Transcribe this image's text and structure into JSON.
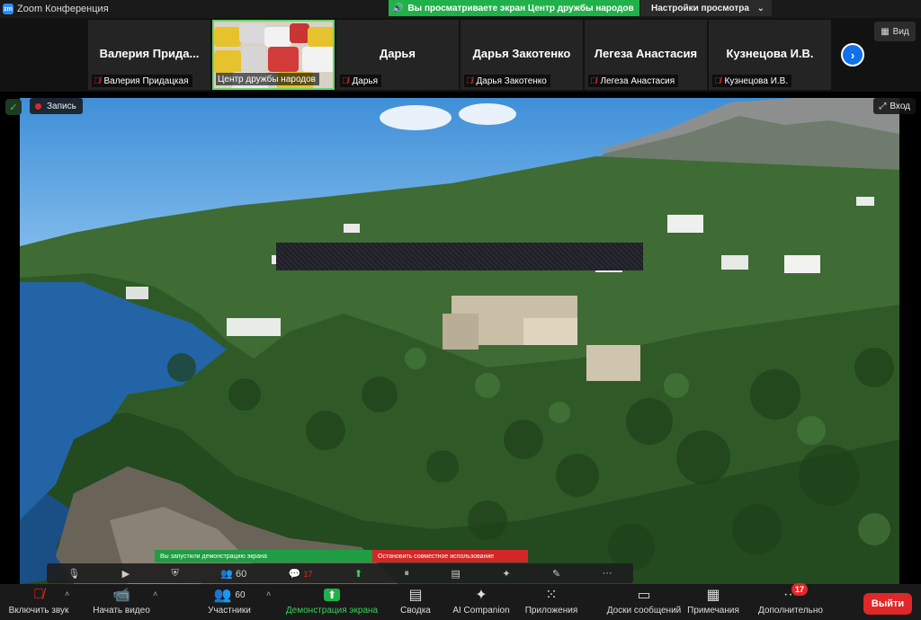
{
  "window": {
    "app_title": "Zoom Конференция",
    "logo": "zm"
  },
  "banner": {
    "text": "Вы просматриваете экран Центр дружбы народов"
  },
  "view_options": {
    "label": "Настройки просмотра"
  },
  "participants": [
    {
      "display_name": "Валерия Придацкая",
      "big_name": "Валерия Прида...",
      "muted": true
    },
    {
      "display_name": "Центр дружбы народов",
      "big_name": "",
      "muted": false,
      "video": true
    },
    {
      "display_name": "Дарья",
      "big_name": "Дарья",
      "muted": true
    },
    {
      "display_name": "Дарья Закотенко",
      "big_name": "Дарья Закотенко",
      "muted": true
    },
    {
      "display_name": "Легеза Анастасия",
      "big_name": "Легеза Анастасия",
      "muted": true
    },
    {
      "display_name": "Кузнецова И.В.",
      "big_name": "Кузнецова И.В.",
      "muted": true
    }
  ],
  "view_button": {
    "label": "Вид"
  },
  "stage": {
    "recording_label": "Запись",
    "exit_label": "Вход"
  },
  "share_control": {
    "status": "Вы запустили демонстрацию экрана",
    "stop": "Остановить совместное использование",
    "participants_count": "60",
    "chat_badge": "17"
  },
  "toolbar": {
    "mute": "Включить звук",
    "video": "Начать видео",
    "participants": "Участники",
    "participants_count": "60",
    "share": "Демонстрация экрана",
    "summary": "Сводка",
    "ai": "AI Companion",
    "apps": "Приложения",
    "whiteboards": "Доски сообщений",
    "notes": "Примечания",
    "more": "Дополнительно",
    "more_badge": "17",
    "leave": "Выйти"
  },
  "colors": {
    "accent_green": "#20b14a",
    "danger_red": "#e02828",
    "zoom_blue": "#0e71eb"
  }
}
